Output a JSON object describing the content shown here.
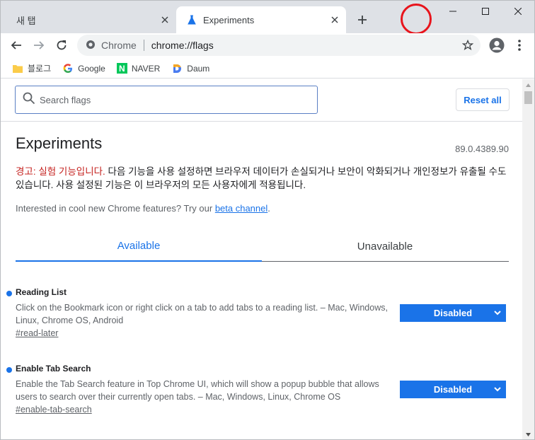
{
  "tabs": {
    "inactive_title": "새 탭",
    "active_title": "Experiments"
  },
  "toolbar": {
    "omnibox_site": "Chrome",
    "omnibox_url": "chrome://flags"
  },
  "bookmarks": [
    {
      "label": "블로그",
      "icon": "folder-icon"
    },
    {
      "label": "Google",
      "icon": "google-icon"
    },
    {
      "label": "NAVER",
      "icon": "naver-icon"
    },
    {
      "label": "Daum",
      "icon": "daum-icon"
    }
  ],
  "search": {
    "placeholder": "Search flags",
    "reset_label": "Reset all"
  },
  "page": {
    "title": "Experiments",
    "version": "89.0.4389.90",
    "warning_red": "경고: 실험 기능입니다.",
    "warning_rest": " 다음 기능을 사용 설정하면 브라우저 데이터가 손실되거나 보안이 악화되거나 개인정보가 유출될 수도 있습니다. 사용 설정된 기능은 이 브라우저의 모든 사용자에게 적용됩니다.",
    "interested_text": "Interested in cool new Chrome features? Try our ",
    "interested_link": "beta channel",
    "interested_end": "."
  },
  "content_tabs": {
    "available": "Available",
    "unavailable": "Unavailable"
  },
  "flags": [
    {
      "name": "Reading List",
      "description": "Click on the Bookmark icon or right click on a tab to add tabs to a reading list. – Mac, Windows, Linux, Chrome OS, Android",
      "link": "#read-later",
      "state": "Disabled"
    },
    {
      "name": "Enable Tab Search",
      "description": "Enable the Tab Search feature in Top Chrome UI, which will show a popup bubble that allows users to search over their currently open tabs. – Mac, Windows, Linux, Chrome OS",
      "link": "#enable-tab-search",
      "state": "Disabled"
    }
  ],
  "colors": {
    "accent": "#1a73e8",
    "warning": "#c5221f",
    "annotation_circle": "#e8141c"
  }
}
